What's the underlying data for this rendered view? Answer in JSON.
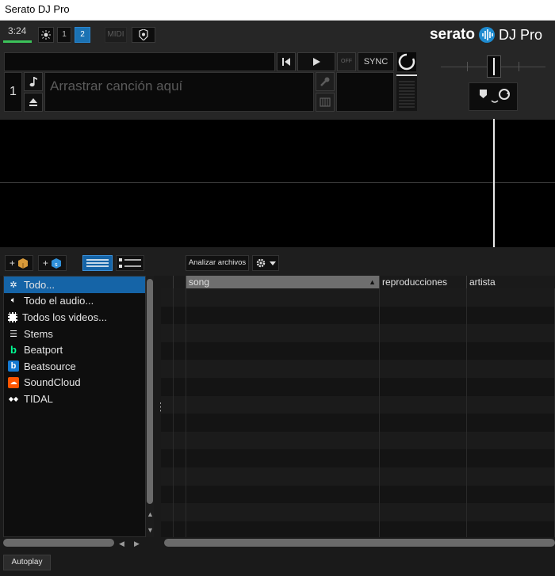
{
  "window": {
    "title": "Serato DJ Pro"
  },
  "topbar": {
    "clock": "3:24",
    "deck1_label": "1",
    "deck2_label": "2",
    "midi_label": "MIDI",
    "logo_text": "serato",
    "logo_suffix": "DJ Pro"
  },
  "deck": {
    "number": "1",
    "drop_placeholder": "Arrastrar canción aquí",
    "off_label": "OFF",
    "sync_label": "SYNC"
  },
  "library": {
    "analyze_label": "Analizar archivos",
    "crates": [
      {
        "label": "Todo...",
        "icon": "gear-burst-icon",
        "selected": true
      },
      {
        "label": "Todo el audio...",
        "icon": "speaker-icon"
      },
      {
        "label": "Todos los videos...",
        "icon": "film-icon"
      },
      {
        "label": "Stems",
        "icon": "stems-icon"
      },
      {
        "label": "Beatport",
        "icon": "beatport-icon",
        "color": "#01ff95"
      },
      {
        "label": "Beatsource",
        "icon": "beatsource-icon",
        "color": "#1478d0"
      },
      {
        "label": "SoundCloud",
        "icon": "soundcloud-icon",
        "color": "#ff5500"
      },
      {
        "label": "TIDAL",
        "icon": "tidal-icon"
      }
    ],
    "columns": [
      {
        "label": "song"
      },
      {
        "label": "reproducciones"
      },
      {
        "label": "artista"
      }
    ]
  },
  "footer": {
    "autoplay_label": "Autoplay"
  },
  "colors": {
    "accent": "#1564a7",
    "sync_green": "#3cc35a"
  }
}
